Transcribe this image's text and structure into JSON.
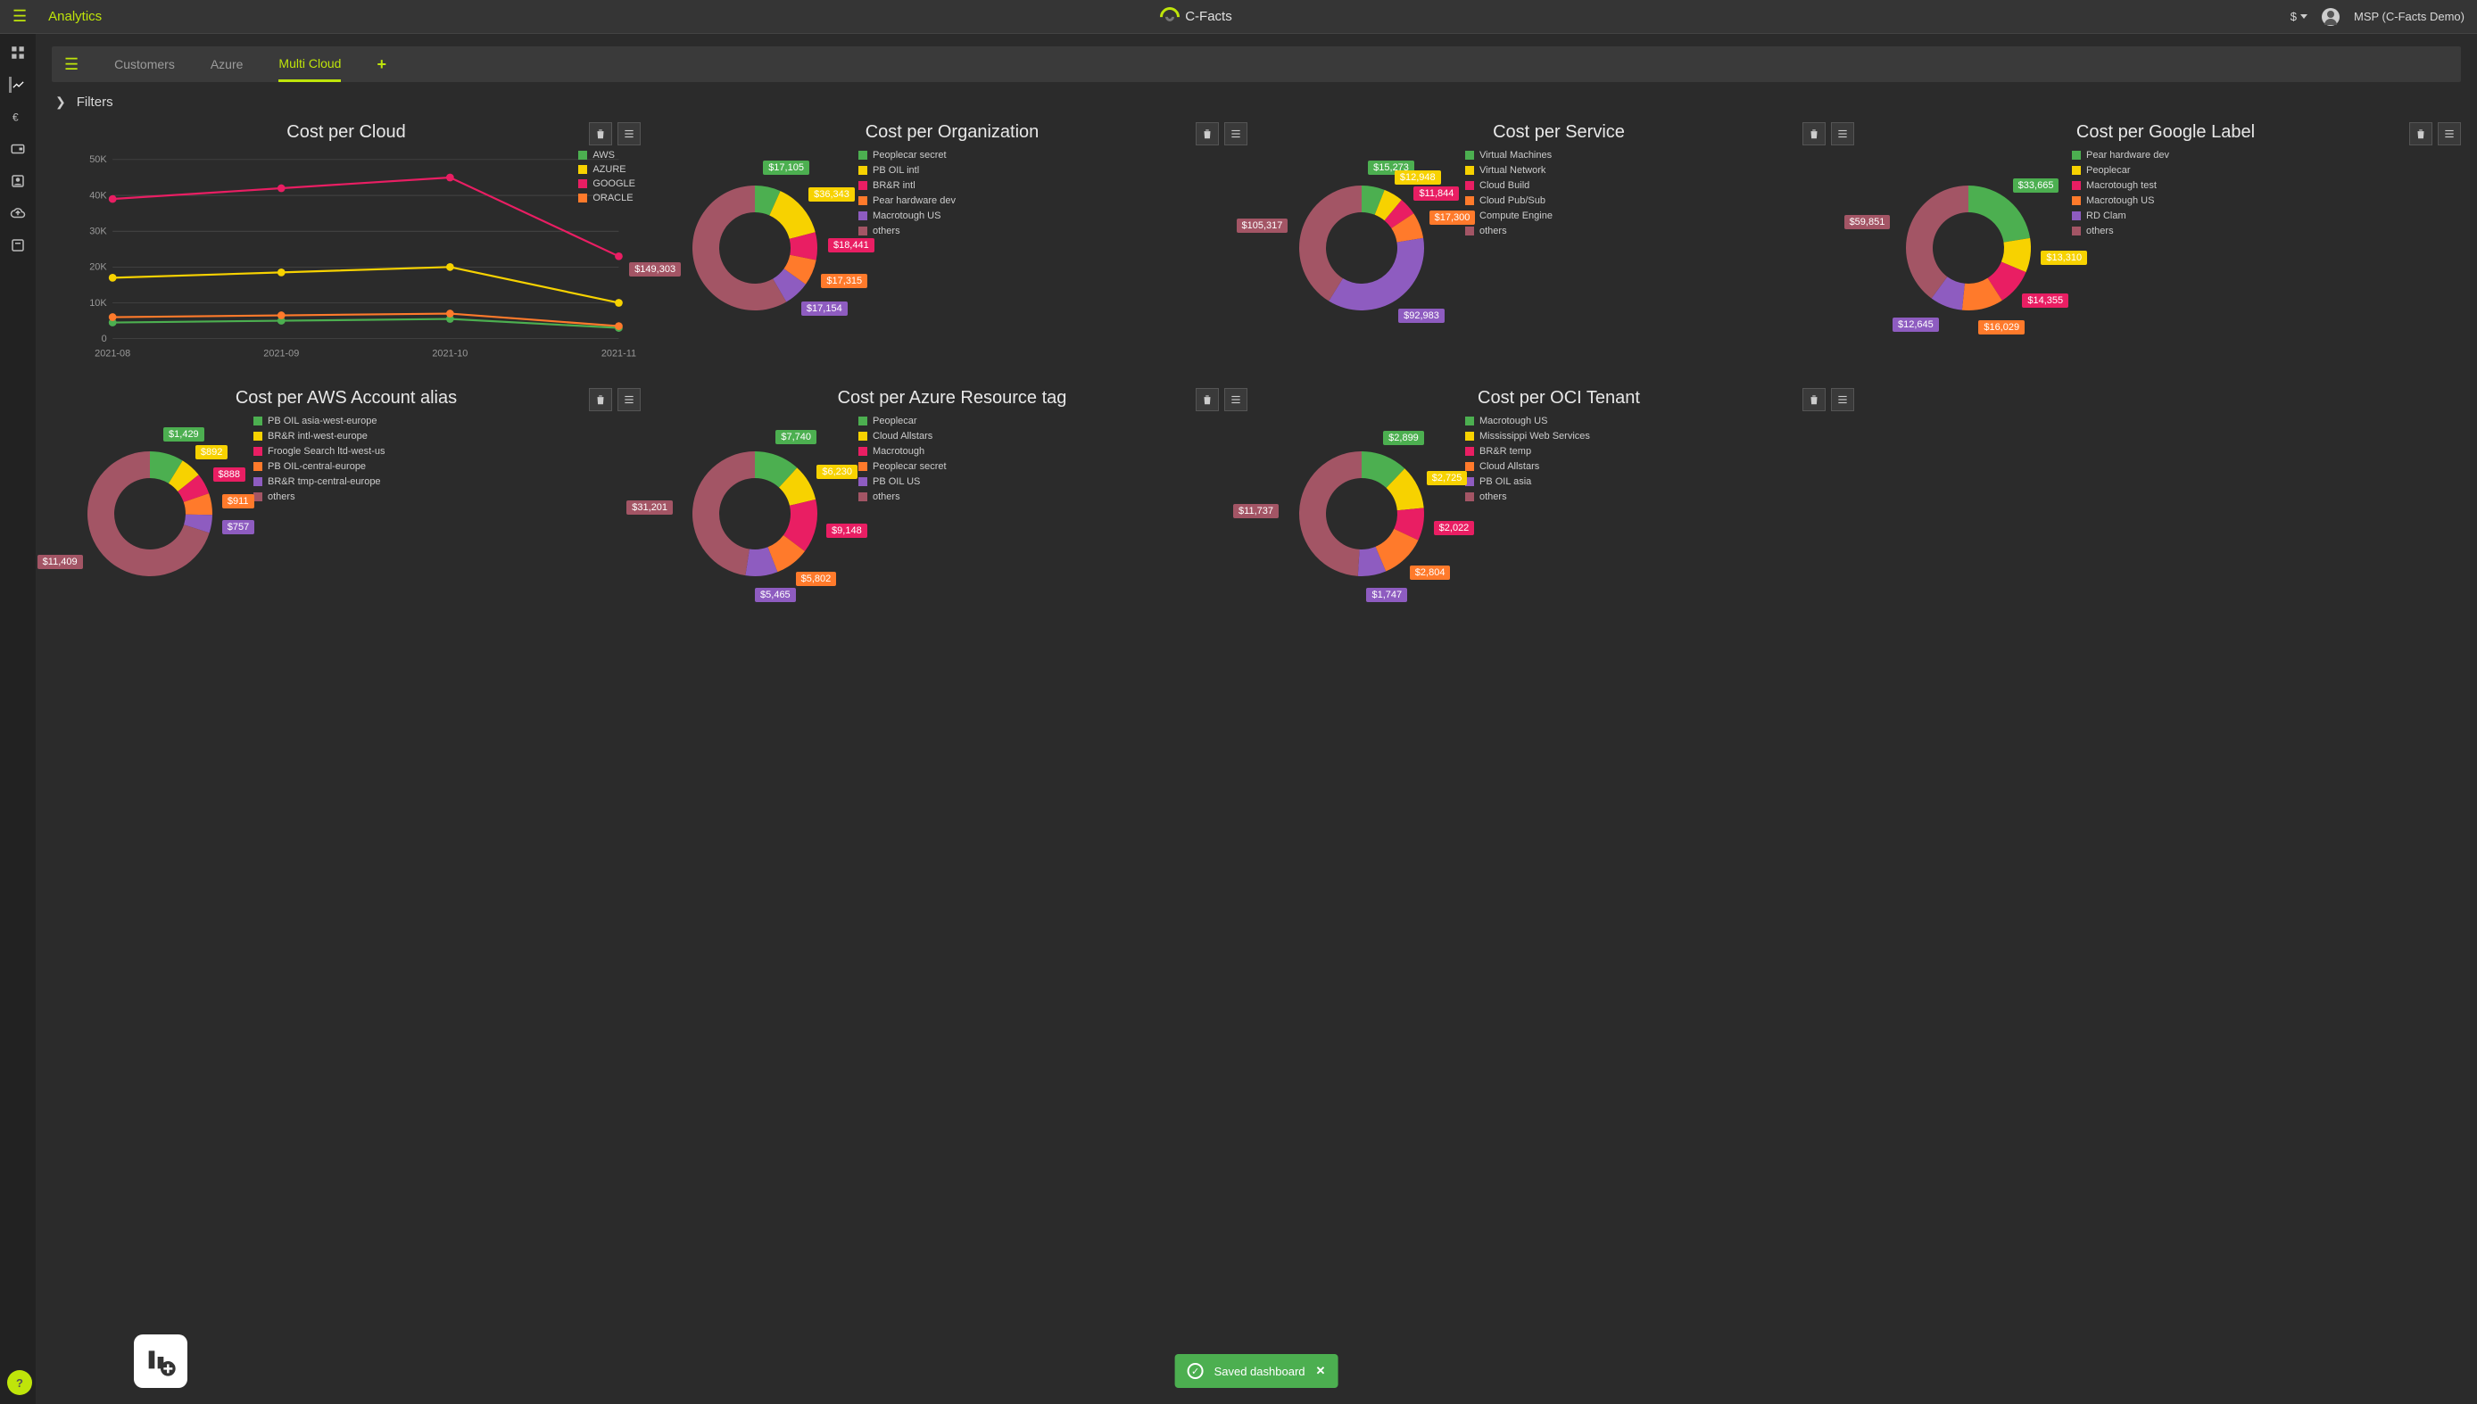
{
  "header": {
    "title": "Analytics",
    "brand": "C-Facts",
    "currency_symbol": "$",
    "account_label": "MSP (C-Facts Demo)"
  },
  "tabs": {
    "items": [
      "Customers",
      "Azure",
      "Multi Cloud"
    ],
    "active_index": 2
  },
  "filters_label": "Filters",
  "toast_text": "Saved dashboard",
  "colors": {
    "green": "#4caf50",
    "yellow": "#f7d200",
    "pink": "#e91e63",
    "orange": "#ff7a2b",
    "purple": "#8e5cc0",
    "maroon": "#a35565"
  },
  "chart_data": [
    {
      "id": "cost_per_cloud",
      "title": "Cost per Cloud",
      "type": "line",
      "x": [
        "2021-08",
        "2021-09",
        "2021-10",
        "2021-11"
      ],
      "ylim": [
        0,
        50000
      ],
      "yticks": [
        0,
        10000,
        20000,
        30000,
        40000,
        50000
      ],
      "ytick_labels": [
        "0",
        "10K",
        "20K",
        "30K",
        "40K",
        "50K"
      ],
      "series": [
        {
          "name": "AWS",
          "color": "green",
          "values": [
            4500,
            5000,
            5500,
            3000
          ]
        },
        {
          "name": "AZURE",
          "color": "yellow",
          "values": [
            17000,
            18500,
            20000,
            10000
          ]
        },
        {
          "name": "GOOGLE",
          "color": "pink",
          "values": [
            39000,
            42000,
            45000,
            23000
          ]
        },
        {
          "name": "ORACLE",
          "color": "orange",
          "values": [
            6000,
            6500,
            7000,
            3500
          ]
        }
      ]
    },
    {
      "id": "cost_per_org",
      "title": "Cost per Organization",
      "type": "donut",
      "slices": [
        {
          "name": "Peoplecar secret",
          "color": "green",
          "value": 17105,
          "label": "$17,105"
        },
        {
          "name": "PB OIL intl",
          "color": "yellow",
          "value": 36343,
          "label": "$36,343"
        },
        {
          "name": "BR&R intl",
          "color": "pink",
          "value": 18441,
          "label": "$18,441"
        },
        {
          "name": "Pear hardware dev",
          "color": "orange",
          "value": 17315,
          "label": "$17,315"
        },
        {
          "name": "Macrotough US",
          "color": "purple",
          "value": 17154,
          "label": "$17,154"
        },
        {
          "name": "others",
          "color": "maroon",
          "value": 149303,
          "label": "$149,303"
        }
      ]
    },
    {
      "id": "cost_per_service",
      "title": "Cost per Service",
      "type": "donut",
      "slices": [
        {
          "name": "Virtual Machines",
          "color": "green",
          "value": 15273,
          "label": "$15,273"
        },
        {
          "name": "Virtual Network",
          "color": "yellow",
          "value": 12948,
          "label": "$12,948"
        },
        {
          "name": "Cloud Build",
          "color": "pink",
          "value": 11844,
          "label": "$11,844"
        },
        {
          "name": "Cloud Pub/Sub",
          "color": "orange",
          "value": 17300,
          "label": "$17,300"
        },
        {
          "name": "Compute Engine",
          "color": "purple",
          "value": 92983,
          "label": "$92,983"
        },
        {
          "name": "others",
          "color": "maroon",
          "value": 105317,
          "label": "$105,317"
        }
      ]
    },
    {
      "id": "cost_per_google_label",
      "title": "Cost per Google Label",
      "type": "donut",
      "slices": [
        {
          "name": "Pear hardware dev",
          "color": "green",
          "value": 33665,
          "label": "$33,665"
        },
        {
          "name": "Peoplecar",
          "color": "yellow",
          "value": 13310,
          "label": "$13,310"
        },
        {
          "name": "Macrotough test",
          "color": "pink",
          "value": 14355,
          "label": "$14,355"
        },
        {
          "name": "Macrotough US",
          "color": "orange",
          "value": 16029,
          "label": "$16,029"
        },
        {
          "name": "RD Clam",
          "color": "purple",
          "value": 12645,
          "label": "$12,645"
        },
        {
          "name": "others",
          "color": "maroon",
          "value": 59851,
          "label": "$59,851"
        }
      ]
    },
    {
      "id": "cost_per_aws_alias",
      "title": "Cost per AWS Account alias",
      "type": "donut",
      "slices": [
        {
          "name": "PB OIL asia-west-europe",
          "color": "green",
          "value": 1429,
          "label": "$1,429"
        },
        {
          "name": "BR&R intl-west-europe",
          "color": "yellow",
          "value": 892,
          "label": "$892"
        },
        {
          "name": "Froogle Search ltd-west-us",
          "color": "pink",
          "value": 888,
          "label": "$888"
        },
        {
          "name": "PB OIL-central-europe",
          "color": "orange",
          "value": 911,
          "label": "$911"
        },
        {
          "name": "BR&R tmp-central-europe",
          "color": "purple",
          "value": 757,
          "label": "$757"
        },
        {
          "name": "others",
          "color": "maroon",
          "value": 11409,
          "label": "$11,409"
        }
      ]
    },
    {
      "id": "cost_per_azure_tag",
      "title": "Cost per Azure Resource tag",
      "type": "donut",
      "slices": [
        {
          "name": "Peoplecar",
          "color": "green",
          "value": 7740,
          "label": "$7,740"
        },
        {
          "name": "Cloud Allstars",
          "color": "yellow",
          "value": 6230,
          "label": "$6,230"
        },
        {
          "name": "Macrotough",
          "color": "pink",
          "value": 9148,
          "label": "$9,148"
        },
        {
          "name": "Peoplecar secret",
          "color": "orange",
          "value": 5802,
          "label": "$5,802"
        },
        {
          "name": "PB OIL US",
          "color": "purple",
          "value": 5465,
          "label": "$5,465"
        },
        {
          "name": "others",
          "color": "maroon",
          "value": 31201,
          "label": "$31,201"
        }
      ]
    },
    {
      "id": "cost_per_oci_tenant",
      "title": "Cost per OCI Tenant",
      "type": "donut",
      "slices": [
        {
          "name": "Macrotough US",
          "color": "green",
          "value": 2899,
          "label": "$2,899"
        },
        {
          "name": "Mississippi Web Services",
          "color": "yellow",
          "value": 2725,
          "label": "$2,725"
        },
        {
          "name": "BR&R temp",
          "color": "pink",
          "value": 2022,
          "label": "$2,022"
        },
        {
          "name": "Cloud Allstars",
          "color": "orange",
          "value": 2804,
          "label": "$2,804"
        },
        {
          "name": "PB OIL asia",
          "color": "purple",
          "value": 1747,
          "label": "$1,747"
        },
        {
          "name": "others",
          "color": "maroon",
          "value": 11737,
          "label": "$11,737"
        }
      ]
    }
  ]
}
